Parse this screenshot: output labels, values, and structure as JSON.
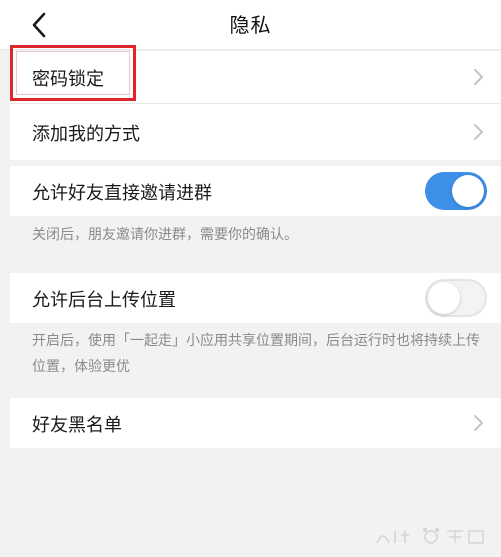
{
  "header": {
    "title": "隐私"
  },
  "rows": {
    "password_lock": {
      "label": "密码锁定"
    },
    "add_method": {
      "label": "添加我的方式"
    },
    "allow_invite": {
      "label": "允许好友直接邀请进群",
      "enabled": true,
      "description": "关闭后，朋友邀请你进群，需要你的确认。"
    },
    "background_location": {
      "label": "允许后台上传位置",
      "enabled": false,
      "description": "开启后，使用「一起走」小应用共享位置期间，后台运行时也将持续上传位置，体验更优"
    },
    "blacklist": {
      "label": "好友黑名单"
    }
  },
  "colors": {
    "toggle_on": "#3d8fe8",
    "highlight": "#e0262a"
  },
  "icons": {
    "back": "back-arrow-icon",
    "chevron": "chevron-right-icon"
  }
}
